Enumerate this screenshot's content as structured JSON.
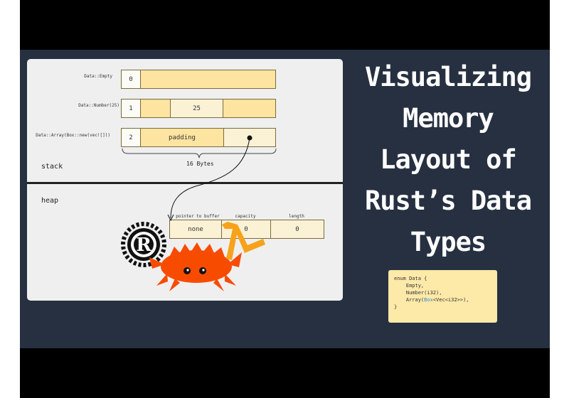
{
  "title": [
    "Visualizing",
    "Memory",
    "Layout of",
    "Rust’s Data",
    "Types"
  ],
  "stack": {
    "label": "stack",
    "size_label": "16 Bytes",
    "rows": [
      {
        "variant": "Data::Empty",
        "tag": "0"
      },
      {
        "variant": "Data::Number(25)",
        "tag": "1",
        "value": "25"
      },
      {
        "variant": "Data::Array(Box::new(vec![]))",
        "tag": "2",
        "padding": "padding"
      }
    ]
  },
  "heap": {
    "label": "heap",
    "headers": [
      "pointer to buffer",
      "capacity",
      "length"
    ],
    "values": [
      "none",
      "0",
      "0"
    ]
  },
  "code": {
    "line1": "enum Data {",
    "line2": "    Empty,",
    "line3": "    Number(i32),",
    "line4_pre": "    Array(",
    "line4_hl": "Box",
    "line4_post": "<Vec<i32>>),",
    "line5": "}"
  }
}
